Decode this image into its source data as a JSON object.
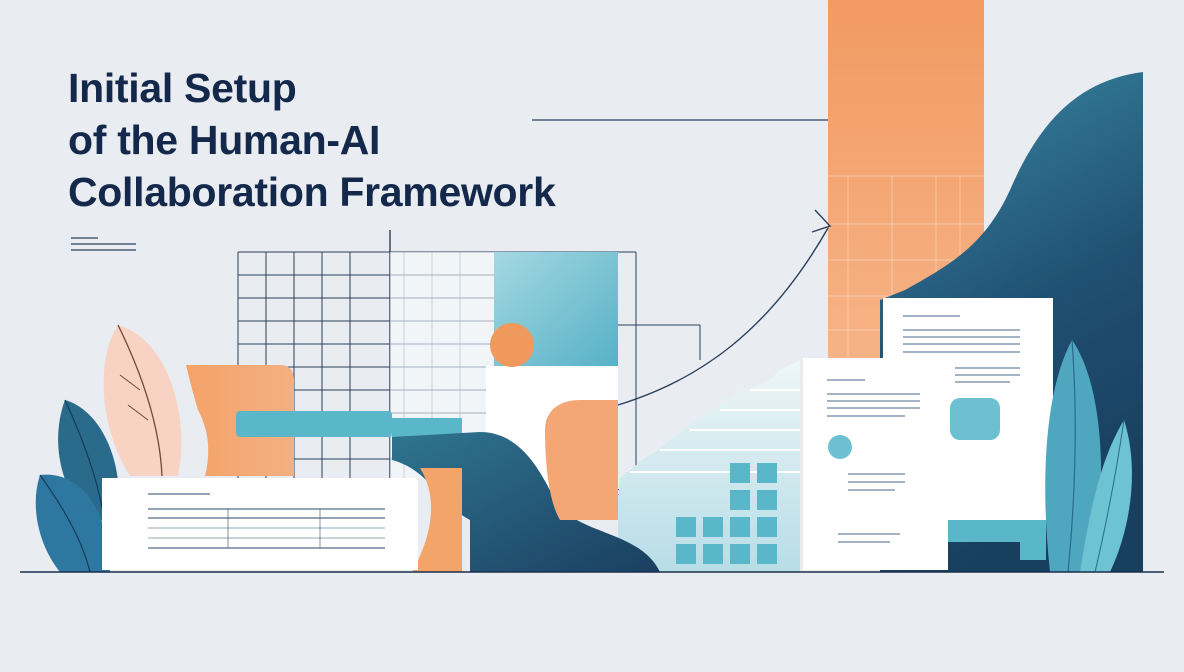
{
  "title_lines": [
    "Initial Setup",
    "of the Human-AI",
    "Collaboration Framework"
  ],
  "colors": {
    "background": "#e9edf1",
    "title": "#14284b",
    "orange": "#f0a064",
    "teal": "#5ab7c9",
    "navy": "#1e4f70",
    "line": "#2b3f5c"
  }
}
